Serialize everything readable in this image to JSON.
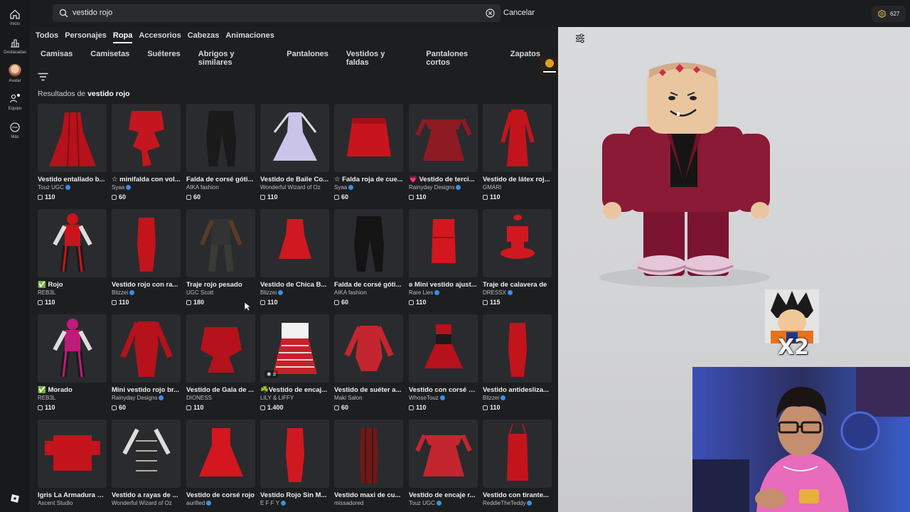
{
  "rail": {
    "items": [
      {
        "label": "Inicio",
        "icon": "home-icon"
      },
      {
        "label": "Destacadas",
        "icon": "chart-icon"
      },
      {
        "label": "Avatar",
        "icon": "avatar-icon"
      },
      {
        "label": "Equipo",
        "icon": "people-icon"
      },
      {
        "label": "Más",
        "icon": "more-icon"
      }
    ]
  },
  "search": {
    "query": "vestido rojo",
    "cancel_label": "Cancelar"
  },
  "robux": {
    "balance": "627"
  },
  "tabs": [
    {
      "label": "Todos",
      "active": false
    },
    {
      "label": "Personajes",
      "active": false
    },
    {
      "label": "Ropa",
      "active": true
    },
    {
      "label": "Accesorios",
      "active": false
    },
    {
      "label": "Cabezas",
      "active": false
    },
    {
      "label": "Animaciones",
      "active": false
    }
  ],
  "subtabs": [
    "Camisas",
    "Camisetas",
    "Suéteres",
    "Abrigos y similares",
    "Pantalones",
    "Vestidos y faldas",
    "Pantalones cortos",
    "Zapatos"
  ],
  "results": {
    "prefix": "Resultados de",
    "query": "vestido rojo"
  },
  "colors": {
    "accent_red": "#c8141c",
    "dark_red": "#8e0d14",
    "verified": "#3a8eea"
  },
  "items": [
    {
      "name": "Vestido entallado b...",
      "creator": "Touz UGC",
      "verified": true,
      "price": "110",
      "shape": "gown",
      "color": "#b5121b"
    },
    {
      "name": "☆ minifalda con vol...",
      "creator": "Syaa",
      "verified": true,
      "price": "60",
      "shape": "ruffle",
      "color": "#c3161e"
    },
    {
      "name": "Falda de corsé góti...",
      "creator": "AIKA fashion",
      "verified": false,
      "price": "60",
      "shape": "pants",
      "color": "#1a1a1a"
    },
    {
      "name": "Vestido de Baile Co...",
      "creator": "Wonderful Wizard of Oz",
      "verified": false,
      "price": "110",
      "shape": "ballgown",
      "color": "#c9c4e8"
    },
    {
      "name": "☆ Falda roja de cue...",
      "creator": "Syaa",
      "verified": true,
      "price": "60",
      "shape": "skirt",
      "color": "#c8141c"
    },
    {
      "name": "💗 Vestido de terci...",
      "creator": "Rainyday Designs",
      "verified": true,
      "price": "110",
      "shape": "offshoulder",
      "color": "#8e1a24"
    },
    {
      "name": "Vestido de látex roj...",
      "creator": "GMARI",
      "verified": false,
      "price": "110",
      "shape": "longsleeve",
      "color": "#c3141c"
    },
    {
      "name": "✅ Rojo",
      "creator": "REB3L",
      "verified": false,
      "price": "110",
      "shape": "suit",
      "color": "#c8141c"
    },
    {
      "name": "Vestido rojo con ra...",
      "creator": "Blizzei",
      "verified": true,
      "price": "110",
      "shape": "tube",
      "color": "#c3141c"
    },
    {
      "name": "Traje rojo pesado",
      "creator": "UGC Scott",
      "verified": false,
      "price": "180",
      "shape": "outfit",
      "color": "#3a3a36"
    },
    {
      "name": "Vestido de Chica B...",
      "creator": "Blizzei",
      "verified": true,
      "price": "110",
      "shape": "mini",
      "color": "#d01820"
    },
    {
      "name": "Falda de corsé góti...",
      "creator": "AIKA fashion",
      "verified": false,
      "price": "60",
      "shape": "pants",
      "color": "#141414"
    },
    {
      "name": "ʚ Mini vestido ajust...",
      "creator": "Rare Lies",
      "verified": true,
      "price": "110",
      "shape": "minitube",
      "color": "#d4161e"
    },
    {
      "name": "Traje de calavera de",
      "creator": "DRESSX",
      "verified": true,
      "price": "115",
      "shape": "corset",
      "color": "#d01820"
    },
    {
      "name": "✅ Morado",
      "creator": "REB3L",
      "verified": false,
      "price": "110",
      "shape": "suit",
      "color": "#c01a7a"
    },
    {
      "name": "Mini vestido rojo br...",
      "creator": "Rainyday Designs",
      "verified": true,
      "price": "60",
      "shape": "shirtdress",
      "color": "#b5121b"
    },
    {
      "name": "Vestido de Gala de ...",
      "creator": "DIONESS",
      "verified": false,
      "price": "110",
      "shape": "bow",
      "color": "#b5121b"
    },
    {
      "name": "☘️Vestido de encaj...",
      "creator": "LILY & LIFFY",
      "verified": false,
      "price": "1.400",
      "shape": "striped",
      "color": "#c8202a",
      "overlay": "✱ #"
    },
    {
      "name": "Vestido de suéter a...",
      "creator": "Maki Salon",
      "verified": false,
      "price": "60",
      "shape": "sweater",
      "color": "#c3262e"
    },
    {
      "name": "Vestido con corsé d...",
      "creator": "WhoseTouz",
      "verified": true,
      "price": "110",
      "shape": "laced",
      "color": "#b5121b"
    },
    {
      "name": "Vestido antidesliza...",
      "creator": "Blizzei",
      "verified": true,
      "price": "110",
      "shape": "tube",
      "color": "#c3141c"
    },
    {
      "name": "Igris La Armadura d...",
      "creator": "Ascent Studio",
      "verified": false,
      "price": "",
      "shape": "armor",
      "color": "#c3141c"
    },
    {
      "name": "Vestido a rayas de ...",
      "creator": "Wonderful Wizard of Oz",
      "verified": false,
      "price": "",
      "shape": "stripedblack",
      "color": "#2a2a2a"
    },
    {
      "name": "Vestido de corsé rojo",
      "creator": "aurified",
      "verified": true,
      "price": "",
      "shape": "corsetdress",
      "color": "#d4161e"
    },
    {
      "name": "Vestido Rojo Sin M...",
      "creator": "E F F Y",
      "verified": true,
      "price": "",
      "shape": "tube",
      "color": "#d01820"
    },
    {
      "name": "Vestido maxi de cu...",
      "creator": "missadored",
      "verified": false,
      "price": "",
      "shape": "leather",
      "color": "#6b1a18"
    },
    {
      "name": "Vestido de encaje r...",
      "creator": "Touz UGC",
      "verified": true,
      "price": "",
      "shape": "offshoulder",
      "color": "#c3262e"
    },
    {
      "name": "Vestido con tirante...",
      "creator": "ReddieTheTeddy",
      "verified": true,
      "price": "",
      "shape": "slip",
      "color": "#c3141c"
    }
  ],
  "sticker": {
    "text": "X2"
  }
}
